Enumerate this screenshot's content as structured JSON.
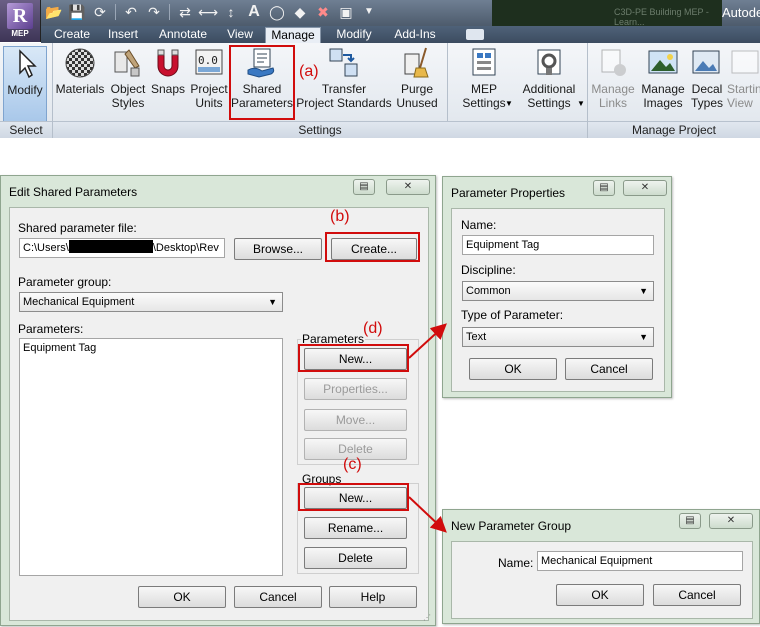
{
  "app": {
    "product_badge": "MEP",
    "title_right": "Autode",
    "dark_strip_text": "C3D-PE Building MEP - Learn..."
  },
  "qat": {
    "icons": [
      "open-icon",
      "save-icon",
      "sync-icon",
      "undo-icon",
      "redo-icon",
      "align-icon",
      "dimension-icon",
      "measure-icon",
      "text-A-icon",
      "3d-view-icon",
      "tag-icon",
      "close-views-icon",
      "switch-windows-icon",
      "dropdown-icon"
    ]
  },
  "tabs": [
    "Create",
    "Insert",
    "Annotate",
    "View",
    "Manage",
    "Modify",
    "Add-Ins"
  ],
  "active_tab": "Manage",
  "ribbon": {
    "modify": "Modify",
    "materials": "Materials",
    "object_styles_1": "Object",
    "object_styles_2": "Styles",
    "snaps": "Snaps",
    "project_units_1": "Project",
    "project_units_2": "Units",
    "shared_params_1": "Shared",
    "shared_params_2": "Parameters",
    "transfer_1": "Transfer",
    "transfer_2": "Project Standards",
    "purge_1": "Purge",
    "purge_2": "Unused",
    "mep_1": "MEP",
    "mep_2": "Settings",
    "additional_1": "Additional",
    "additional_2": "Settings",
    "manage_links_1": "Manage",
    "manage_links_2": "Links",
    "manage_images_1": "Manage",
    "manage_images_2": "Images",
    "decal_1": "Decal",
    "decal_2": "Types",
    "starting_1": "Startin",
    "starting_2": "View",
    "panel_select": "Select",
    "panel_settings": "Settings",
    "panel_manage_project": "Manage Project"
  },
  "annotations": {
    "a": "(a)",
    "b": "(b)",
    "c": "(c)",
    "d": "(d)",
    "color": "#d10c0c"
  },
  "edit_shared": {
    "title": "Edit Shared Parameters",
    "file_label": "Shared parameter file:",
    "file_prefix": "C:\\Users\\",
    "file_suffix": "\\Desktop\\Rev",
    "browse": "Browse...",
    "create": "Create...",
    "group_label": "Parameter group:",
    "group_value": "Mechanical Equipment",
    "params_label": "Parameters:",
    "params_list": [
      "Equipment Tag"
    ],
    "parameters_box": "Parameters",
    "p_new": "New...",
    "p_properties": "Properties...",
    "p_move": "Move...",
    "p_delete": "Delete",
    "groups_box": "Groups",
    "g_new": "New...",
    "g_rename": "Rename...",
    "g_delete": "Delete",
    "ok": "OK",
    "cancel": "Cancel",
    "help": "Help"
  },
  "param_props": {
    "title": "Parameter Properties",
    "name_label": "Name:",
    "name_value": "Equipment Tag",
    "discipline_label": "Discipline:",
    "discipline_value": "Common",
    "type_label": "Type of Parameter:",
    "type_value": "Text",
    "ok": "OK",
    "cancel": "Cancel"
  },
  "new_group": {
    "title": "New Parameter Group",
    "name_label": "Name:",
    "name_value": "Mechanical Equipment",
    "ok": "OK",
    "cancel": "Cancel"
  }
}
